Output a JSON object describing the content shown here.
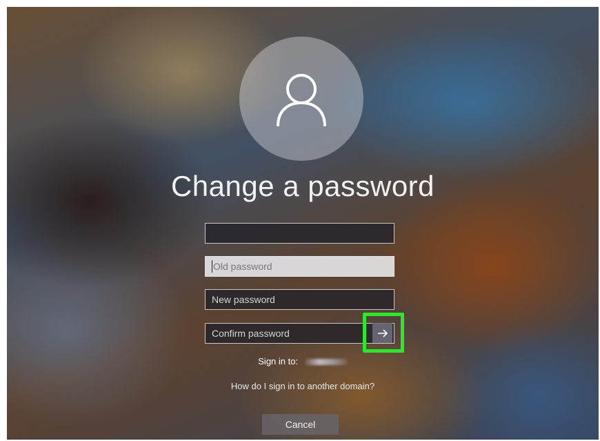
{
  "title": "Change a password",
  "fields": {
    "username": {
      "value": ""
    },
    "old_password": {
      "placeholder": "Old password",
      "focused": true
    },
    "new_password": {
      "placeholder": "New password"
    },
    "confirm_password": {
      "placeholder": "Confirm password"
    }
  },
  "submit_icon": "right-arrow-icon",
  "sign_in": {
    "label": "Sign in to:"
  },
  "domain_help_link": "How do I sign in to another domain?",
  "cancel_label": "Cancel",
  "colors": {
    "highlight": "#2ee62e"
  }
}
